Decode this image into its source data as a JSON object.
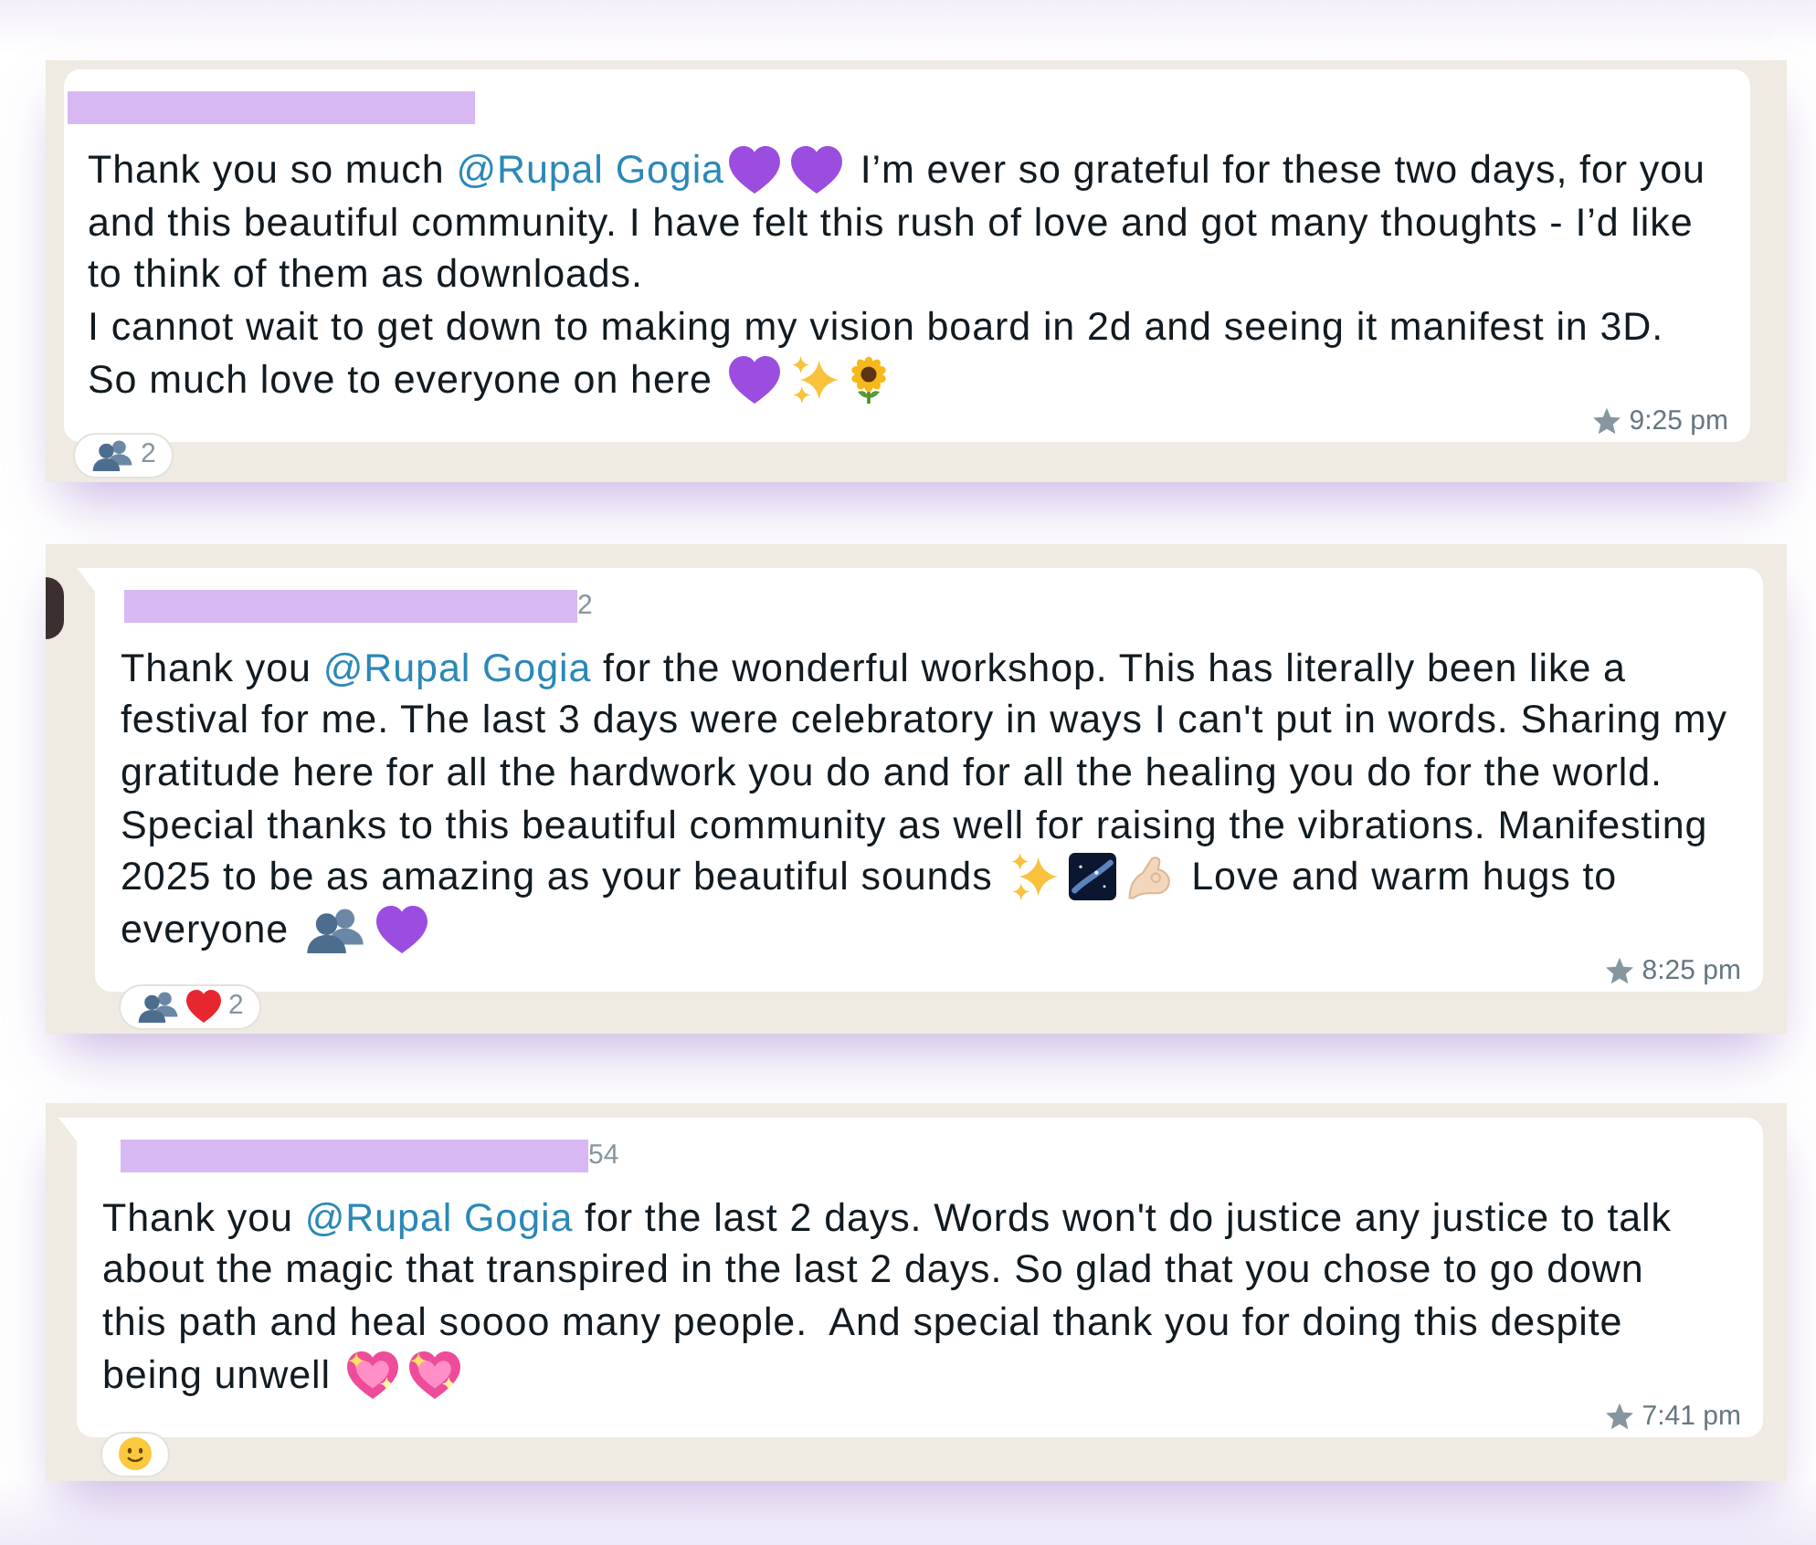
{
  "messages": [
    {
      "sender": {
        "redacted": true
      },
      "avatar": false,
      "tail": false,
      "content": [
        {
          "kind": "text",
          "text": "Thank you so much "
        },
        {
          "kind": "mention",
          "text": "@Rupal Gogia"
        },
        {
          "kind": "heart",
          "color": "#9b4de0"
        },
        {
          "kind": "heart",
          "color": "#9b4de0"
        },
        {
          "kind": "text",
          "text": " I’m ever so grateful for these two days, for you and this beautiful community. I have felt this rush of love and got many thoughts - I’d like to think of them as downloads.\nI cannot wait to get down to making my vision board in 2d and seeing it manifest in 3D.\nSo much love to everyone on here "
        },
        {
          "kind": "heart",
          "color": "#9b4de0"
        },
        {
          "kind": "sparkles"
        },
        {
          "kind": "sunflower"
        }
      ],
      "starred": true,
      "time": "9:25 pm",
      "reactions": {
        "emojis": [
          {
            "kind": "busts"
          }
        ],
        "count": "2"
      }
    },
    {
      "sender": {
        "redacted": true,
        "visible_text": "2"
      },
      "avatar": true,
      "tail": true,
      "content": [
        {
          "kind": "text",
          "text": "Thank you "
        },
        {
          "kind": "mention",
          "text": "@Rupal Gogia"
        },
        {
          "kind": "text",
          "text": " for the wonderful workshop. This has literally been like a festival for me. The last 3 days were celebratory in ways I can't put in words. Sharing my gratitude here for all the hardwork you do and for all the healing you do for the world. Special thanks to this beautiful community as well for raising the vibrations. Manifesting 2025 to be as amazing as your beautiful sounds "
        },
        {
          "kind": "sparkles"
        },
        {
          "kind": "galaxy"
        },
        {
          "kind": "pinch"
        },
        {
          "kind": "text",
          "text": " Love and warm hugs to everyone "
        },
        {
          "kind": "busts"
        },
        {
          "kind": "heart",
          "color": "#9b4de0"
        }
      ],
      "starred": true,
      "time": "8:25 pm",
      "reactions": {
        "emojis": [
          {
            "kind": "busts"
          },
          {
            "kind": "heart",
            "color": "#e8262f"
          }
        ],
        "count": "2"
      }
    },
    {
      "sender": {
        "redacted": true,
        "visible_text": "54"
      },
      "avatar": false,
      "tail": true,
      "content": [
        {
          "kind": "text",
          "text": "Thank you "
        },
        {
          "kind": "mention",
          "text": "@Rupal Gogia"
        },
        {
          "kind": "text",
          "text": " for the last 2 days. Words won't do justice any justice to talk about the magic that transpired in the last 2 days. So glad that you chose to go down this path and heal soooo many people.  And special thank you for doing this despite being unwell "
        },
        {
          "kind": "sparkleheart"
        },
        {
          "kind": "sparkleheart"
        }
      ],
      "starred": true,
      "time": "7:41 pm",
      "reactions": {
        "emojis": [
          {
            "kind": "face"
          }
        ]
      }
    }
  ]
}
